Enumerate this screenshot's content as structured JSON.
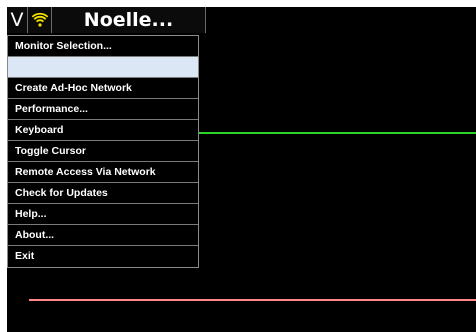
{
  "header": {
    "menu_button": "V",
    "title": "Noelle...",
    "wifi_icon": "wifi-icon",
    "wifi_color": "#f2e200"
  },
  "menu": {
    "items": [
      {
        "label": "Monitor Selection..."
      },
      {
        "label": "",
        "state": "highlighted"
      },
      {
        "label": "Create Ad-Hoc Network"
      },
      {
        "label": "Performance..."
      },
      {
        "label": "Keyboard"
      },
      {
        "label": "Toggle Cursor"
      },
      {
        "label": "Remote Access Via Network"
      },
      {
        "label": "Check for Updates"
      },
      {
        "label": "Help..."
      },
      {
        "label": "About..."
      },
      {
        "label": "Exit"
      }
    ]
  },
  "traces": {
    "green_color": "#2bd42b",
    "red_color": "#ff8a8a"
  }
}
